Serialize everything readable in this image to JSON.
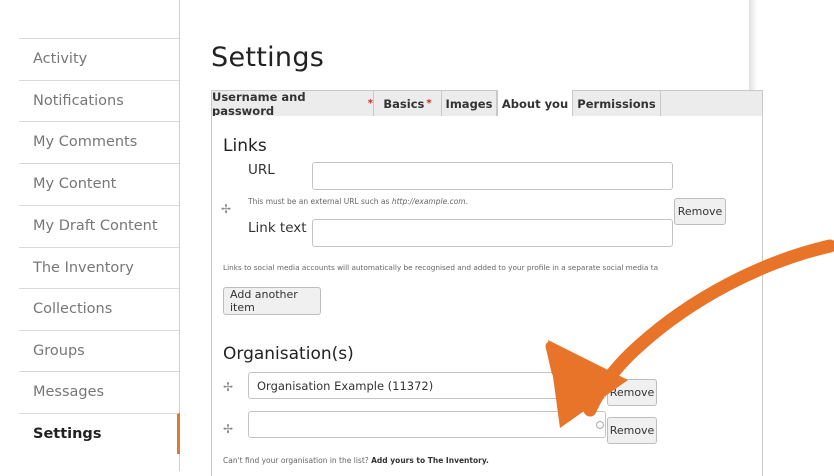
{
  "sidebar": {
    "items": [
      {
        "label": "Activity"
      },
      {
        "label": "Notifications"
      },
      {
        "label": "My Comments"
      },
      {
        "label": "My Content"
      },
      {
        "label": "My Draft Content"
      },
      {
        "label": "The Inventory"
      },
      {
        "label": "Collections"
      },
      {
        "label": "Groups"
      },
      {
        "label": "Messages"
      },
      {
        "label": "Settings",
        "active": true
      }
    ]
  },
  "page": {
    "title": "Settings"
  },
  "tabs": [
    {
      "label": "Username and password",
      "required": "*"
    },
    {
      "label": "Basics",
      "required": "*"
    },
    {
      "label": "Images"
    },
    {
      "label": "About you",
      "active": true
    },
    {
      "label": "Permissions"
    }
  ],
  "links": {
    "heading": "Links",
    "url_label": "URL",
    "url_value": "",
    "url_hint_prefix": "This must be an external URL such as ",
    "url_hint_example": "http://example.com",
    "url_hint_suffix": ".",
    "link_text_label": "Link text",
    "link_text_value": "",
    "remove_label": "Remove",
    "social_hint": "Links to social media accounts will automatically be recognised and added to your profile in a separate social media ta",
    "add_another_label": "Add another item"
  },
  "organisations": {
    "heading": "Organisation(s)",
    "rows": [
      {
        "value": "Organisation Example (11372)",
        "remove_label": "Remove"
      },
      {
        "value": "",
        "remove_label": "Remove"
      }
    ],
    "footer_prefix": "Can't find your organisation in the list? ",
    "footer_link": "Add yours to The Inventory."
  },
  "icons": {
    "drag": "drag-handle-icon",
    "autocomplete": "autocomplete-indicator-icon",
    "annotation": "orange-arrow-annotation"
  },
  "colors": {
    "accent": "#e07a2e",
    "required": "#dd2222",
    "arrow": "#e8742a"
  }
}
